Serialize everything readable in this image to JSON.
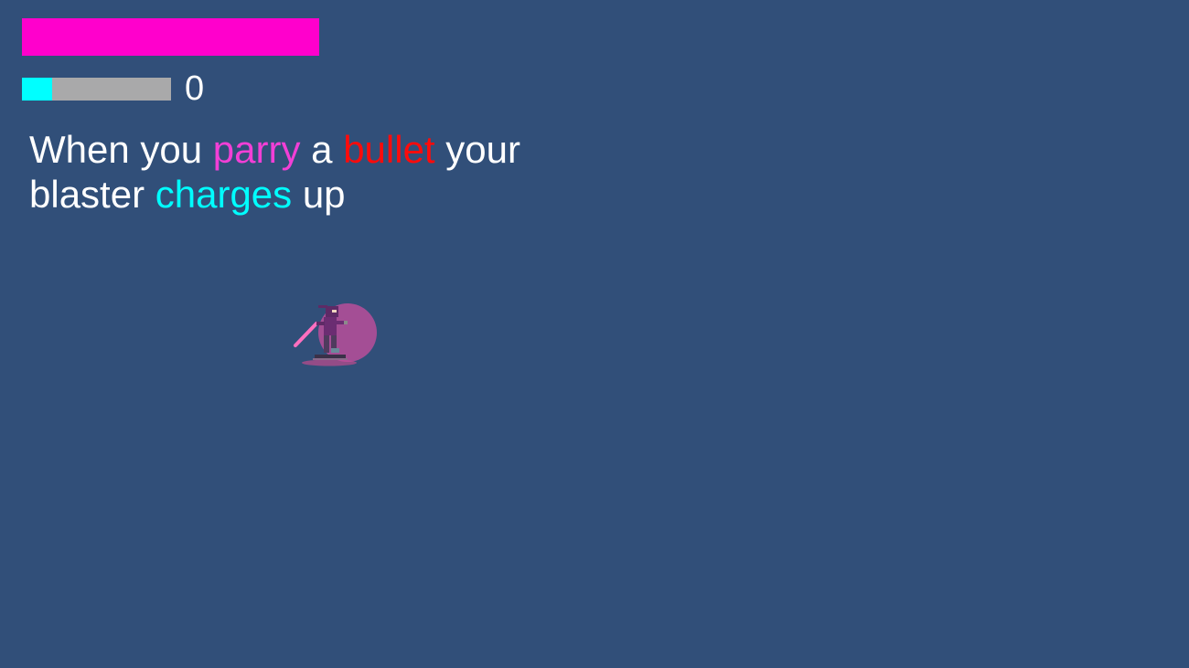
{
  "hud": {
    "health": {
      "value": 1.0,
      "color": "#ff00cc"
    },
    "blaster_charge": {
      "value": 0.2,
      "fill_color": "#00ffff",
      "track_color": "#a9a9aa",
      "count": "0"
    }
  },
  "tutorial": {
    "segments": [
      {
        "text": "When you ",
        "highlight": "none"
      },
      {
        "text": "parry",
        "highlight": "parry"
      },
      {
        "text": " a ",
        "highlight": "none"
      },
      {
        "text": "bullet",
        "highlight": "bullet"
      },
      {
        "text": " your blaster ",
        "highlight": "none"
      },
      {
        "text": "charges",
        "highlight": "charges"
      },
      {
        "text": " up",
        "highlight": "none"
      }
    ]
  },
  "player": {
    "sprite": "ninja-with-pink-sword-icon",
    "parry_shield": "parry-bubble-icon",
    "colors": {
      "body": "#6b2d72",
      "sword": "#ff6fbf",
      "shield": "#c54e9e"
    }
  },
  "colors": {
    "background": "#314f79",
    "text": "#ffffff",
    "parry": "#f23fd6",
    "bullet": "#ff0b0b",
    "charges": "#00ffff"
  }
}
